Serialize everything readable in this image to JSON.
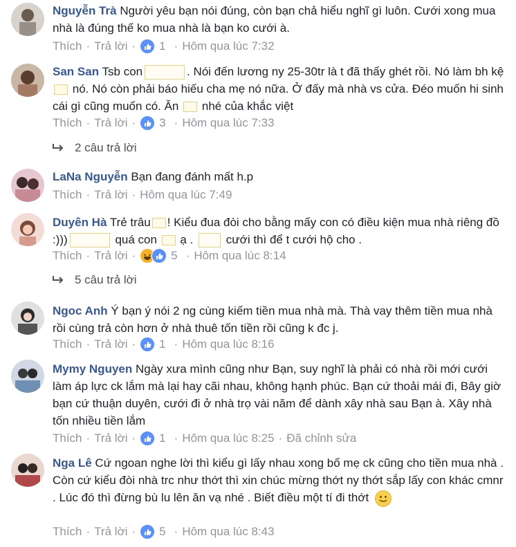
{
  "labels": {
    "like": "Thích",
    "reply": "Trả lời",
    "dot": "·"
  },
  "comments": [
    {
      "name": "Nguyễn Trà",
      "text_parts": [
        "Người yêu bạn nói đúng, còn bạn chả hiểu nghĩ gì luôn. Cưới xong mua nhà là đúng thế ko mua nhà là bạn ko cưới à."
      ],
      "reactions": "1",
      "time": "Hôm qua lúc 7:32"
    },
    {
      "name": "San San",
      "text_parts": [
        "Tsb con",
        ". Nói đến lương ny 25-30tr là t đã thấy ghét rồi. Nó làm bh kệ",
        "nó. Nó còn phải báo hiếu cha mẹ nó nữa. Ở đấy mà nhà vs cửa. Đéo muốn hi sinh cái gì cũng muốn có. Ăn",
        "nhé của khắc việt"
      ],
      "reactions": "3",
      "time": "Hôm qua lúc 7:33",
      "replies": "2 câu trả lời"
    },
    {
      "name": "LaNa Nguyễn",
      "text_parts": [
        "Bạn đang đánh mất h.p"
      ],
      "time": "Hôm qua lúc 7:49"
    },
    {
      "name": "Duyên Hà",
      "text_parts": [
        "Trẻ trâu",
        "! Kiểu đua đòi cho bằng mấy con có điều kiện mua nhà riêng đồ :)))",
        "quá con",
        "ạ .",
        "cưới thì để t cưới hộ cho ."
      ],
      "reactions": "5",
      "time": "Hôm qua lúc 8:14",
      "replies": "5 câu trả lời"
    },
    {
      "name": "Ngoc Anh",
      "text_parts": [
        "Ý bạn ý nói 2 ng cùng kiếm tiền mua nhà mà. Thà vay thêm tiền mua nhà rồi cùng trả còn hơn ở nhà thuê tốn tiền rồi cũng k đc j."
      ],
      "reactions": "1",
      "time": "Hôm qua lúc 8:16"
    },
    {
      "name": "Mymy Nguyen",
      "text_parts": [
        "Ngày xưa mình cũng như Bạn, suy nghĩ là phải có nhà rồi mới cưới làm áp lực ck lắm mà lại hay cãi nhau, không hạnh phúc. Bạn cứ thoải mái đi, Bây giờ bạn cứ thuận duyên, cưới đi ở nhà trọ vài năm để dành xây nhà sau Bạn à. Xây nhà tốn nhiều tiền lắm"
      ],
      "reactions": "1",
      "time": "Hôm qua lúc 8:25",
      "edited": "Đã chỉnh sửa"
    },
    {
      "name": "Nga Lê",
      "text_parts": [
        "Cứ ngoan nghe lời thì kiểu gì lấy nhau xong bố mẹ ck cũng cho tiền mua nhà . Còn cứ kiểu đòi nhà trc như thớt thì xin chúc mừng thớt ny thớt sắp lấy con khác cmnr . Lúc đó thì đừng bù lu lên ăn vạ nhé . Biết điều một tí đi thớt"
      ],
      "reactions": "5",
      "time": "Hôm qua lúc 8:43"
    }
  ],
  "colors": {
    "name": "#365899",
    "meta": "#90949c",
    "like_blue": "#5890ff"
  }
}
